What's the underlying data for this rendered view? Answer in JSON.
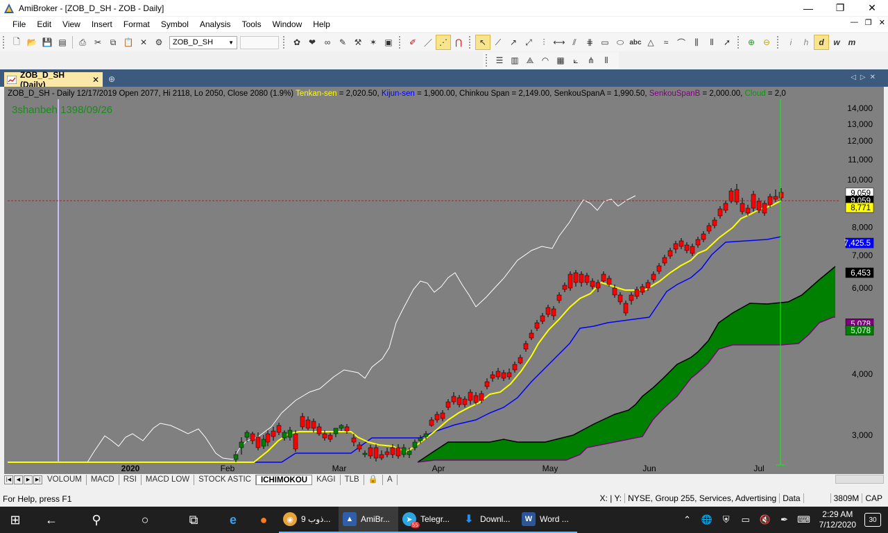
{
  "window": {
    "title": "AmiBroker - [ZOB_D_SH - ZOB - Daily]",
    "controls": [
      "minimize-icon",
      "maximize-icon",
      "close-icon"
    ]
  },
  "menu": [
    "File",
    "Edit",
    "View",
    "Insert",
    "Format",
    "Symbol",
    "Analysis",
    "Tools",
    "Window",
    "Help"
  ],
  "toolbar": {
    "symbol_value": "ZOB_D_SH",
    "interval_buttons": [
      "i",
      "h",
      "d",
      "w",
      "m"
    ],
    "active_interval": "d"
  },
  "doc_tab": {
    "label": "ZOB_D_SH (Daily)"
  },
  "chart": {
    "header": {
      "prefix": "ZOB_D_SH - Daily 12/17/2019 Open 2077, Hi 2118, Lo 2050, Close 2080 (1.9%) ",
      "tenkan_name": "Tenkan-sen",
      "tenkan_val": " = 2,020.50, ",
      "kijun_name": "Kijun-sen",
      "kijun_val": " = 1,900.00, Chinkou Span = 2,149.00, ",
      "senkouA_name": "SenkouSpanA",
      "senkouA_val": " = 1,990.50, ",
      "senkouB_name": "SenkouSpanB",
      "senkouB_val": " = 2,000.00, ",
      "cloud_name": "Cloud",
      "cloud_val": " = 2,0"
    },
    "date_note": "3shanbeh 1398/09/26",
    "colors": {
      "background": "#808080",
      "tenkan": "#ffff00",
      "kijun": "#0000ff",
      "chikou": "#ffffff",
      "cloud_fill": "#008000",
      "senkou_a": "#000000",
      "senkou_b": "#800080",
      "up_candle": "#008000",
      "down_candle": "#ff0000"
    }
  },
  "chart_data": {
    "type": "candlestick",
    "y_scale": "log",
    "ylim": [
      2600,
      15000
    ],
    "y_ticks": [
      "14,000",
      "13,000",
      "12,000",
      "11,000",
      "10,000",
      "9,000",
      "8,000",
      "7,000",
      "6,000",
      "5,000",
      "4,000",
      "3,000"
    ],
    "x_labels": [
      "2020",
      "Feb",
      "Mar",
      "Apr",
      "May",
      "Jun",
      "Jul"
    ],
    "price_labels": [
      {
        "text": "9,059",
        "value": 9400,
        "bg": "#ffffff",
        "fg": "#000000"
      },
      {
        "text": "9,059",
        "value": 9059,
        "bg": "#000000",
        "fg": "#ffffff"
      },
      {
        "text": "8,771",
        "value": 8771,
        "bg": "#ffff00",
        "fg": "#000000"
      },
      {
        "text": "7,425.5",
        "value": 7425,
        "bg": "#0000ff",
        "fg": "#ffffff"
      },
      {
        "text": "6,453",
        "value": 6453,
        "bg": "#000000",
        "fg": "#ffffff"
      },
      {
        "text": "5,078",
        "value": 5078,
        "bg": "#800080",
        "fg": "#ffffff"
      },
      {
        "text": "5,078",
        "value": 4920,
        "bg": "#008000",
        "fg": "#ffffff"
      }
    ],
    "last_close": 9059
  },
  "sheets": [
    "VOLOUM",
    "MACD",
    "RSI",
    "MACD LOW",
    "STOCK ASTIC",
    "ICHIMOKOU",
    "KAGI",
    "TLB"
  ],
  "active_sheet": "ICHIMOKOU",
  "status": {
    "help": "For Help, press F1",
    "coords": "X: | Y:",
    "group": "NYSE, Group 255, Services, Advertising",
    "data": "Data",
    "memory": "3809M",
    "cap": "CAP"
  },
  "taskbar": {
    "apps": [
      {
        "label": "ذوب 9...",
        "color": "#e8a33b"
      },
      {
        "label": "AmiBr...",
        "color": "#2f5faa"
      },
      {
        "label": "Telegr...",
        "color": "#2ca5e0"
      },
      {
        "label": "Downl...",
        "color": "#1e90ff"
      },
      {
        "label": "Word ...",
        "color": "#2b579a"
      }
    ],
    "telegram_badge": "55",
    "time": "2:29 AM",
    "date": "7/12/2020",
    "notifications": "30"
  }
}
